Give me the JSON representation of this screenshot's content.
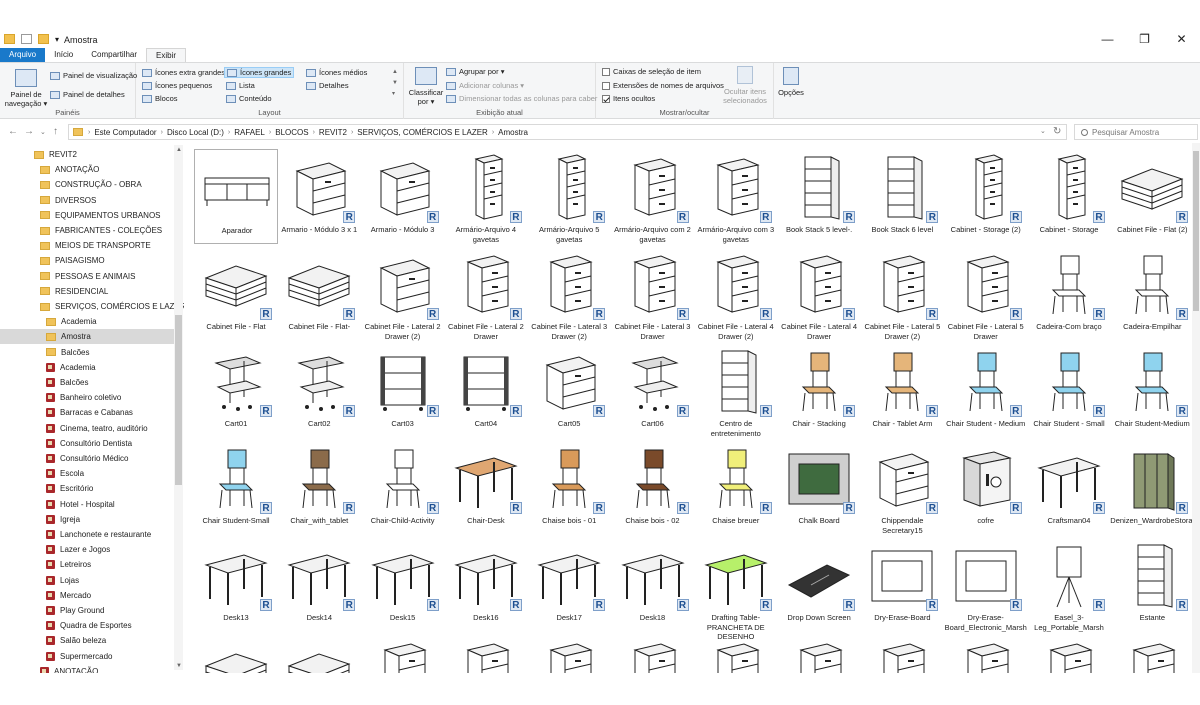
{
  "window": {
    "title": "Amostra",
    "min": "—",
    "max": "❐",
    "close": "✕"
  },
  "tabs": [
    "Arquivo",
    "Início",
    "Compartilhar",
    "Exibir"
  ],
  "ribbon": {
    "paineis": {
      "nav": "Painel de navegação ▾",
      "preview": "Painel de visualização",
      "details": "Painel de detalhes",
      "label": "Painéis"
    },
    "layout": {
      "items": [
        "Ícones extra grandes",
        "Ícones grandes",
        "Ícones médios",
        "Ícones pequenos",
        "Lista",
        "Detalhes",
        "Blocos",
        "Conteúdo"
      ],
      "label": "Layout"
    },
    "exibicao": {
      "sort": "Classificar por ▾",
      "group": "Agrupar por ▾",
      "addcols": "Adicionar colunas ▾",
      "sizecols": "Dimensionar todas as colunas para caber",
      "label": "Exibição atual"
    },
    "mostrar": {
      "checkboxes": "Caixas de seleção de item",
      "extensions": "Extensões de nomes de arquivos",
      "hidden": "Itens ocultos",
      "hide_sel": "Ocultar itens selecionados",
      "label": "Mostrar/ocultar"
    },
    "opcoes": "Opções"
  },
  "address": {
    "crumbs": [
      "Este Computador",
      "Disco Local (D:)",
      "RAFAEL",
      "BLOCOS",
      "REVIT2",
      "SERVIÇOS, COMÉRCIOS E LAZER",
      "Amostra"
    ],
    "search_placeholder": "Pesquisar Amostra",
    "back": "←",
    "forward": "→",
    "up": "↑",
    "refresh": "↻",
    "dropdown": "⌄"
  },
  "sidebar": {
    "items": [
      {
        "label": "REVIT2",
        "icon": "folder",
        "indent": 0
      },
      {
        "label": "ANOTAÇÃO",
        "icon": "folder",
        "indent": 1
      },
      {
        "label": "CONSTRUÇÃO - OBRA",
        "icon": "folder",
        "indent": 1
      },
      {
        "label": "DIVERSOS",
        "icon": "folder",
        "indent": 1
      },
      {
        "label": "EQUIPAMENTOS URBANOS",
        "icon": "folder",
        "indent": 1
      },
      {
        "label": "FABRICANTES - COLEÇÕES",
        "icon": "folder",
        "indent": 1
      },
      {
        "label": "MEIOS DE TRANSPORTE",
        "icon": "folder",
        "indent": 1
      },
      {
        "label": "PAISAGISMO",
        "icon": "folder",
        "indent": 1
      },
      {
        "label": "PESSOAS E ANIMAIS",
        "icon": "folder",
        "indent": 1
      },
      {
        "label": "RESIDENCIAL",
        "icon": "folder",
        "indent": 1
      },
      {
        "label": "SERVIÇOS, COMÉRCIOS E LAZER",
        "icon": "folder",
        "indent": 1
      },
      {
        "label": "Academia",
        "icon": "folder",
        "indent": 2
      },
      {
        "label": "Amostra",
        "icon": "folder",
        "indent": 2,
        "selected": true
      },
      {
        "label": "Balcões",
        "icon": "folder",
        "indent": 2
      },
      {
        "label": "Academia",
        "icon": "revit",
        "indent": 2
      },
      {
        "label": "Balcões",
        "icon": "revit",
        "indent": 2
      },
      {
        "label": "Banheiro coletivo",
        "icon": "revit",
        "indent": 2
      },
      {
        "label": "Barracas e Cabanas",
        "icon": "revit",
        "indent": 2
      },
      {
        "label": "Cinema, teatro, auditório",
        "icon": "revit",
        "indent": 2
      },
      {
        "label": "Consultório Dentista",
        "icon": "revit",
        "indent": 2
      },
      {
        "label": "Consultório Médico",
        "icon": "revit",
        "indent": 2
      },
      {
        "label": "Escola",
        "icon": "revit",
        "indent": 2
      },
      {
        "label": "Escritório",
        "icon": "revit",
        "indent": 2
      },
      {
        "label": "Hotel - Hospital",
        "icon": "revit",
        "indent": 2
      },
      {
        "label": "Igreja",
        "icon": "revit",
        "indent": 2
      },
      {
        "label": "Lanchonete e restaurante",
        "icon": "revit",
        "indent": 2
      },
      {
        "label": "Lazer e Jogos",
        "icon": "revit",
        "indent": 2
      },
      {
        "label": "Letreiros",
        "icon": "revit",
        "indent": 2
      },
      {
        "label": "Lojas",
        "icon": "revit",
        "indent": 2
      },
      {
        "label": "Mercado",
        "icon": "revit",
        "indent": 2
      },
      {
        "label": "Play Ground",
        "icon": "revit",
        "indent": 2
      },
      {
        "label": "Quadra de Esportes",
        "icon": "revit",
        "indent": 2
      },
      {
        "label": "Salão beleza",
        "icon": "revit",
        "indent": 2
      },
      {
        "label": "Supermercado",
        "icon": "revit",
        "indent": 2
      },
      {
        "label": "ANOTAÇÃO",
        "icon": "revit",
        "indent": 1
      }
    ]
  },
  "files": [
    {
      "label": "Aparador",
      "kind": "sideboard",
      "selected": true
    },
    {
      "label": "Armario - Módulo 3 x 1",
      "kind": "cabinet"
    },
    {
      "label": "Armario - Módulo 3",
      "kind": "cabinet"
    },
    {
      "label": "Armário-Arquivo 4 gavetas",
      "kind": "tall"
    },
    {
      "label": "Armário-Arquivo 5 gavetas",
      "kind": "tall"
    },
    {
      "label": "Armário-Arquivo com 2 gavetas",
      "kind": "file"
    },
    {
      "label": "Armário-Arquivo com 3 gavetas",
      "kind": "file"
    },
    {
      "label": "Book Stack 5 level-.",
      "kind": "shelf"
    },
    {
      "label": "Book Stack 6 level",
      "kind": "shelf"
    },
    {
      "label": "Cabinet - Storage (2)",
      "kind": "tall"
    },
    {
      "label": "Cabinet - Storage",
      "kind": "tall"
    },
    {
      "label": "Cabinet File - Flat (2)",
      "kind": "flat"
    },
    {
      "label": "Cabinet File - Flat",
      "kind": "flat"
    },
    {
      "label": "Cabinet File - Flat-",
      "kind": "flat"
    },
    {
      "label": "Cabinet File - Lateral 2 Drawer (2)",
      "kind": "cabinet"
    },
    {
      "label": "Cabinet File - Lateral 2 Drawer",
      "kind": "file"
    },
    {
      "label": "Cabinet File - Lateral 3 Drawer (2)",
      "kind": "file"
    },
    {
      "label": "Cabinet File - Lateral 3 Drawer",
      "kind": "file"
    },
    {
      "label": "Cabinet File - Lateral 4 Drawer (2)",
      "kind": "file"
    },
    {
      "label": "Cabinet File - Lateral 4 Drawer",
      "kind": "file"
    },
    {
      "label": "Cabinet File - Lateral 5 Drawer (2)",
      "kind": "file"
    },
    {
      "label": "Cabinet File - Lateral 5 Drawer",
      "kind": "file"
    },
    {
      "label": "Cadeira-Com braço",
      "kind": "chair"
    },
    {
      "label": "Cadeira-Empilhar",
      "kind": "chair"
    },
    {
      "label": "Cart01",
      "kind": "cart"
    },
    {
      "label": "Cart02",
      "kind": "cart"
    },
    {
      "label": "Cart03",
      "kind": "cartshelf"
    },
    {
      "label": "Cart04",
      "kind": "cartshelf"
    },
    {
      "label": "Cart05",
      "kind": "cabinet"
    },
    {
      "label": "Cart06",
      "kind": "cart"
    },
    {
      "label": "Centro de entretenimento",
      "kind": "shelf"
    },
    {
      "label": "Chair - Stacking",
      "kind": "chair",
      "color": "#e5b57a"
    },
    {
      "label": "Chair - Tablet Arm",
      "kind": "chair",
      "color": "#e5b57a"
    },
    {
      "label": "Chair Student - Medium",
      "kind": "chair",
      "color": "#8fd3ee"
    },
    {
      "label": "Chair Student - Small",
      "kind": "chair",
      "color": "#8fd3ee"
    },
    {
      "label": "Chair Student-Medium",
      "kind": "chair",
      "color": "#8fd3ee"
    },
    {
      "label": "Chair Student-Small",
      "kind": "chair",
      "color": "#8fd3ee"
    },
    {
      "label": "Chair_with_tablet",
      "kind": "chair",
      "color": "#8b6b4a"
    },
    {
      "label": "Chair-Child-Activity",
      "kind": "chair"
    },
    {
      "label": "Chair-Desk",
      "kind": "desk",
      "color": "#e0a772"
    },
    {
      "label": "Chaise bois - 01",
      "kind": "chair",
      "color": "#d99a5a"
    },
    {
      "label": "Chaise bois - 02",
      "kind": "chair",
      "color": "#7a4a2a"
    },
    {
      "label": "Chaise breuer",
      "kind": "chair",
      "color": "#f0ef7a"
    },
    {
      "label": "Chalk Board",
      "kind": "board",
      "color": "#3f6b3f"
    },
    {
      "label": "Chippendale Secretary15",
      "kind": "cabinet"
    },
    {
      "label": "cofre",
      "kind": "safe"
    },
    {
      "label": "Craftsman04",
      "kind": "desk"
    },
    {
      "label": "Denizen_WardrobeStorageTower_3D",
      "kind": "wardrobe",
      "color": "#8f9a74"
    },
    {
      "label": "Desk13",
      "kind": "desk"
    },
    {
      "label": "Desk14",
      "kind": "desk"
    },
    {
      "label": "Desk15",
      "kind": "desk"
    },
    {
      "label": "Desk16",
      "kind": "desk"
    },
    {
      "label": "Desk17",
      "kind": "desk"
    },
    {
      "label": "Desk18",
      "kind": "desk"
    },
    {
      "label": "Drafting Table-PRANCHETA DE DESENHO",
      "kind": "desk",
      "color": "#b7f06a"
    },
    {
      "label": "Drop Down Screen",
      "kind": "screen"
    },
    {
      "label": "Dry-Erase-Board",
      "kind": "board",
      "color": "#ffffff"
    },
    {
      "label": "Dry-Erase-Board_Electronic_Marsh",
      "kind": "board",
      "color": "#ffffff"
    },
    {
      "label": "Easel_3-Leg_Portable_Marsh",
      "kind": "easel"
    },
    {
      "label": "Estante",
      "kind": "shelf"
    },
    {
      "label": "",
      "kind": "flat"
    },
    {
      "label": "",
      "kind": "flat"
    },
    {
      "label": "",
      "kind": "file"
    },
    {
      "label": "",
      "kind": "file"
    },
    {
      "label": "",
      "kind": "file"
    },
    {
      "label": "",
      "kind": "file"
    },
    {
      "label": "",
      "kind": "file"
    },
    {
      "label": "",
      "kind": "file"
    },
    {
      "label": "",
      "kind": "file"
    },
    {
      "label": "",
      "kind": "file"
    },
    {
      "label": "",
      "kind": "file"
    },
    {
      "label": "",
      "kind": "file"
    }
  ],
  "colors": {
    "accent": "#1979ca",
    "selection": "#cce4f7",
    "revit_badge": "#1d4f91"
  }
}
